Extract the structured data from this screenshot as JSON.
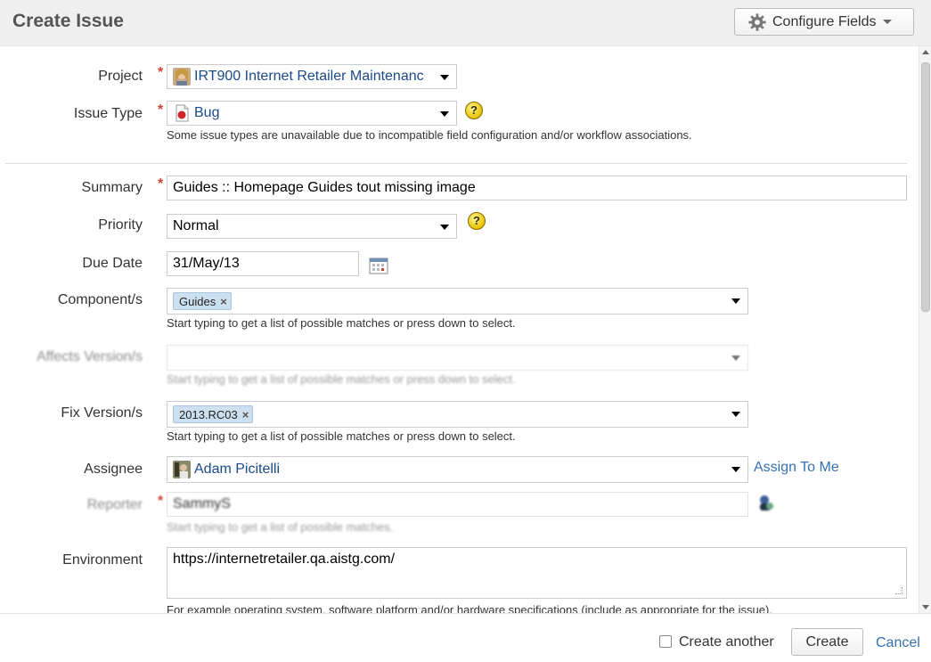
{
  "dialog": {
    "title": "Create Issue"
  },
  "toolbar": {
    "configure_fields_label": "Configure Fields"
  },
  "project": {
    "label": "Project",
    "value": "IRT900 Internet Retailer Maintenanc"
  },
  "issue_type": {
    "label": "Issue Type",
    "value": "Bug",
    "hint": "Some issue types are unavailable due to incompatible field configuration and/or workflow associations."
  },
  "summary": {
    "label": "Summary",
    "value": "Guides :: Homepage Guides tout missing image"
  },
  "priority": {
    "label": "Priority",
    "value": "Normal"
  },
  "due_date": {
    "label": "Due Date",
    "value": "31/May/13"
  },
  "components": {
    "label": "Component/s",
    "chips": [
      "Guides"
    ],
    "hint": "Start typing to get a list of possible matches or press down to select."
  },
  "affects_version": {
    "label": "Affects Version/s",
    "hint": "Start typing to get a list of possible matches or press down to select."
  },
  "fix_version": {
    "label": "Fix Version/s",
    "chips": [
      "2013.RC03"
    ],
    "hint": "Start typing to get a list of possible matches or press down to select."
  },
  "assignee": {
    "label": "Assignee",
    "value": "Adam Picitelli",
    "assign_to_me": "Assign To Me"
  },
  "reporter": {
    "label": "Reporter",
    "value": "SammyS",
    "hint": "Start typing to get a list of possible matches."
  },
  "environment": {
    "label": "Environment",
    "value": "https://internetretailer.qa.aistg.com/",
    "hint": "For example operating system, software platform and/or hardware specifications (include as appropriate for the issue)."
  },
  "footer": {
    "create_another_label": "Create another",
    "create_label": "Create",
    "cancel_label": "Cancel"
  },
  "colors": {
    "accent_link": "#3572b0",
    "required": "#d04437",
    "chip_bg": "#cde0f0"
  },
  "icons": {
    "gear": "gear-icon",
    "project_avatar": "project-avatar",
    "bug": "bug-icon",
    "help": "help-icon",
    "calendar": "calendar-icon",
    "chip_remove": "remove-icon",
    "assignee_avatar": "avatar",
    "user_picker": "user-picker-icon"
  }
}
